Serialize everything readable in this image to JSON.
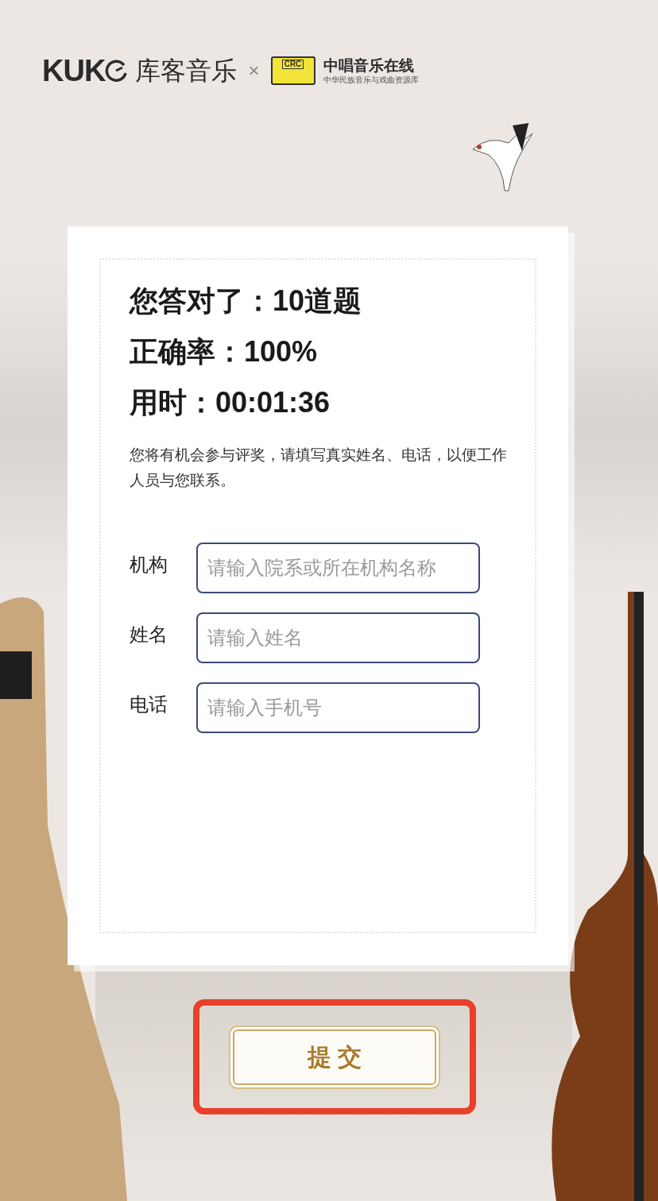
{
  "header": {
    "logo_text": "KUK",
    "brand": "库客音乐",
    "separator": "×",
    "partner_badge": "CRC",
    "partner_name": "中唱音乐在线",
    "partner_subtitle": "中华民族音乐与戏曲资源库"
  },
  "results": [
    {
      "label": "您答对了：",
      "value": "10道题"
    },
    {
      "label": "正确率：",
      "value": "100%"
    },
    {
      "label": "用时：",
      "value": "00:01:36"
    }
  ],
  "note": "您将有机会参与评奖，请填写真实姓名、电话，以便工作人员与您联系。",
  "form": {
    "fields": [
      {
        "label": "机构",
        "placeholder": "请输入院系或所在机构名称"
      },
      {
        "label": "姓名",
        "placeholder": "请输入姓名"
      },
      {
        "label": "电话",
        "placeholder": "请输入手机号"
      }
    ]
  },
  "submit_button": {
    "label": "提 交",
    "highlighted": true
  }
}
